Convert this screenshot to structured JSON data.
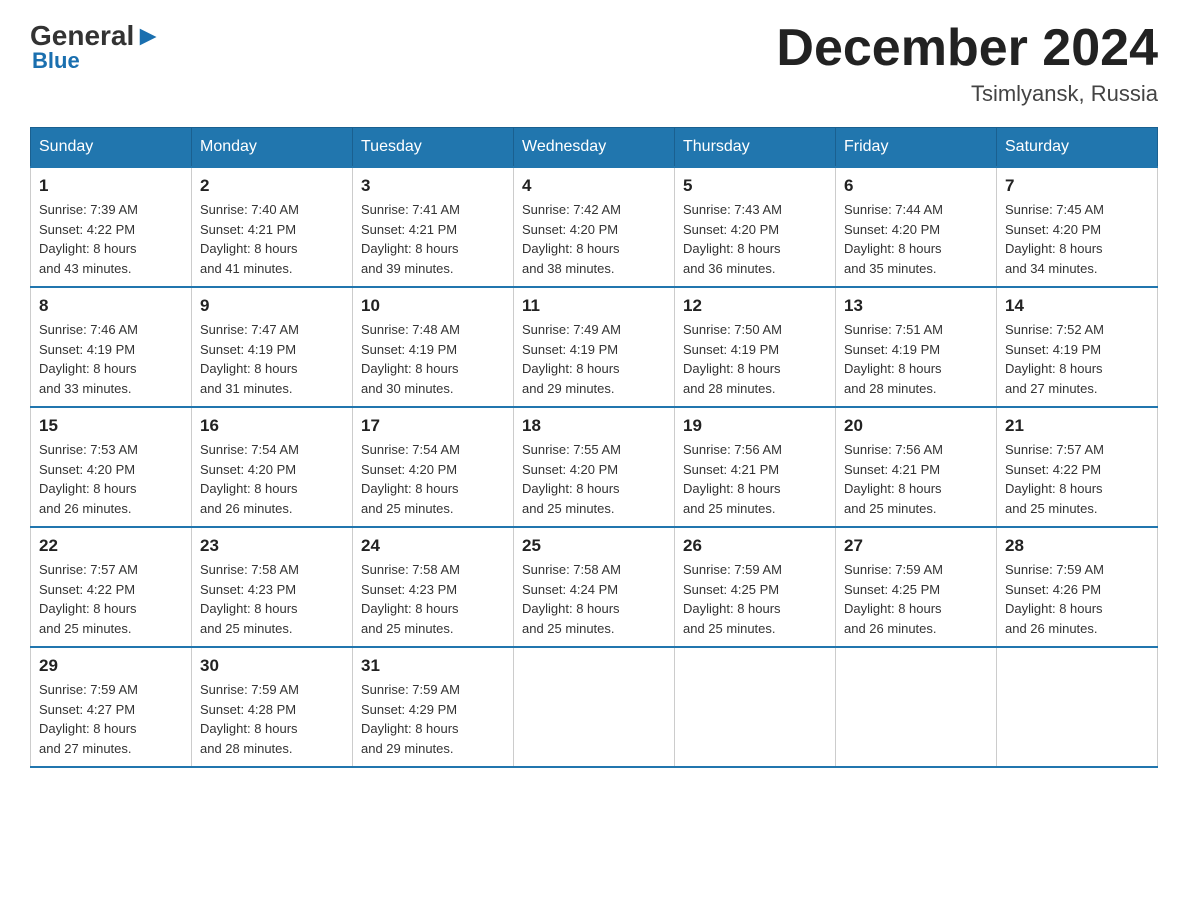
{
  "header": {
    "logo": {
      "general": "General",
      "blue": "Blue"
    },
    "title": "December 2024",
    "location": "Tsimlyansk, Russia"
  },
  "days_of_week": [
    "Sunday",
    "Monday",
    "Tuesday",
    "Wednesday",
    "Thursday",
    "Friday",
    "Saturday"
  ],
  "weeks": [
    [
      {
        "day": "1",
        "sunrise": "7:39 AM",
        "sunset": "4:22 PM",
        "daylight": "8 hours and 43 minutes."
      },
      {
        "day": "2",
        "sunrise": "7:40 AM",
        "sunset": "4:21 PM",
        "daylight": "8 hours and 41 minutes."
      },
      {
        "day": "3",
        "sunrise": "7:41 AM",
        "sunset": "4:21 PM",
        "daylight": "8 hours and 39 minutes."
      },
      {
        "day": "4",
        "sunrise": "7:42 AM",
        "sunset": "4:20 PM",
        "daylight": "8 hours and 38 minutes."
      },
      {
        "day": "5",
        "sunrise": "7:43 AM",
        "sunset": "4:20 PM",
        "daylight": "8 hours and 36 minutes."
      },
      {
        "day": "6",
        "sunrise": "7:44 AM",
        "sunset": "4:20 PM",
        "daylight": "8 hours and 35 minutes."
      },
      {
        "day": "7",
        "sunrise": "7:45 AM",
        "sunset": "4:20 PM",
        "daylight": "8 hours and 34 minutes."
      }
    ],
    [
      {
        "day": "8",
        "sunrise": "7:46 AM",
        "sunset": "4:19 PM",
        "daylight": "8 hours and 33 minutes."
      },
      {
        "day": "9",
        "sunrise": "7:47 AM",
        "sunset": "4:19 PM",
        "daylight": "8 hours and 31 minutes."
      },
      {
        "day": "10",
        "sunrise": "7:48 AM",
        "sunset": "4:19 PM",
        "daylight": "8 hours and 30 minutes."
      },
      {
        "day": "11",
        "sunrise": "7:49 AM",
        "sunset": "4:19 PM",
        "daylight": "8 hours and 29 minutes."
      },
      {
        "day": "12",
        "sunrise": "7:50 AM",
        "sunset": "4:19 PM",
        "daylight": "8 hours and 28 minutes."
      },
      {
        "day": "13",
        "sunrise": "7:51 AM",
        "sunset": "4:19 PM",
        "daylight": "8 hours and 28 minutes."
      },
      {
        "day": "14",
        "sunrise": "7:52 AM",
        "sunset": "4:19 PM",
        "daylight": "8 hours and 27 minutes."
      }
    ],
    [
      {
        "day": "15",
        "sunrise": "7:53 AM",
        "sunset": "4:20 PM",
        "daylight": "8 hours and 26 minutes."
      },
      {
        "day": "16",
        "sunrise": "7:54 AM",
        "sunset": "4:20 PM",
        "daylight": "8 hours and 26 minutes."
      },
      {
        "day": "17",
        "sunrise": "7:54 AM",
        "sunset": "4:20 PM",
        "daylight": "8 hours and 25 minutes."
      },
      {
        "day": "18",
        "sunrise": "7:55 AM",
        "sunset": "4:20 PM",
        "daylight": "8 hours and 25 minutes."
      },
      {
        "day": "19",
        "sunrise": "7:56 AM",
        "sunset": "4:21 PM",
        "daylight": "8 hours and 25 minutes."
      },
      {
        "day": "20",
        "sunrise": "7:56 AM",
        "sunset": "4:21 PM",
        "daylight": "8 hours and 25 minutes."
      },
      {
        "day": "21",
        "sunrise": "7:57 AM",
        "sunset": "4:22 PM",
        "daylight": "8 hours and 25 minutes."
      }
    ],
    [
      {
        "day": "22",
        "sunrise": "7:57 AM",
        "sunset": "4:22 PM",
        "daylight": "8 hours and 25 minutes."
      },
      {
        "day": "23",
        "sunrise": "7:58 AM",
        "sunset": "4:23 PM",
        "daylight": "8 hours and 25 minutes."
      },
      {
        "day": "24",
        "sunrise": "7:58 AM",
        "sunset": "4:23 PM",
        "daylight": "8 hours and 25 minutes."
      },
      {
        "day": "25",
        "sunrise": "7:58 AM",
        "sunset": "4:24 PM",
        "daylight": "8 hours and 25 minutes."
      },
      {
        "day": "26",
        "sunrise": "7:59 AM",
        "sunset": "4:25 PM",
        "daylight": "8 hours and 25 minutes."
      },
      {
        "day": "27",
        "sunrise": "7:59 AM",
        "sunset": "4:25 PM",
        "daylight": "8 hours and 26 minutes."
      },
      {
        "day": "28",
        "sunrise": "7:59 AM",
        "sunset": "4:26 PM",
        "daylight": "8 hours and 26 minutes."
      }
    ],
    [
      {
        "day": "29",
        "sunrise": "7:59 AM",
        "sunset": "4:27 PM",
        "daylight": "8 hours and 27 minutes."
      },
      {
        "day": "30",
        "sunrise": "7:59 AM",
        "sunset": "4:28 PM",
        "daylight": "8 hours and 28 minutes."
      },
      {
        "day": "31",
        "sunrise": "7:59 AM",
        "sunset": "4:29 PM",
        "daylight": "8 hours and 29 minutes."
      },
      null,
      null,
      null,
      null
    ]
  ],
  "labels": {
    "sunrise": "Sunrise:",
    "sunset": "Sunset:",
    "daylight": "Daylight:"
  }
}
